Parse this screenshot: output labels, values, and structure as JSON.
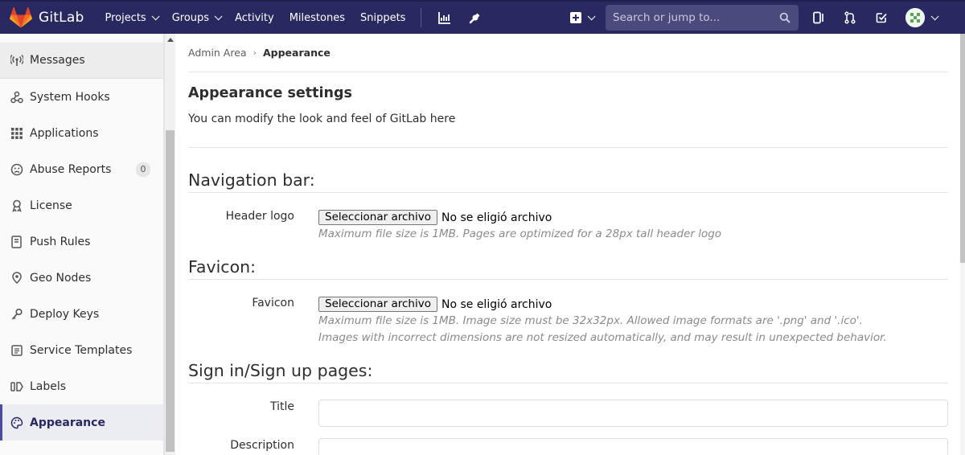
{
  "navbar": {
    "brand": "GitLab",
    "links": [
      "Projects",
      "Groups",
      "Activity",
      "Milestones",
      "Snippets"
    ],
    "search_placeholder": "Search or jump to..."
  },
  "sidebar": {
    "items": [
      {
        "label": "Messages",
        "icon": "broadcast-icon"
      },
      {
        "label": "System Hooks",
        "icon": "hook-icon"
      },
      {
        "label": "Applications",
        "icon": "applications-grid-icon"
      },
      {
        "label": "Abuse Reports",
        "icon": "abuse-face-icon",
        "count": "0"
      },
      {
        "label": "License",
        "icon": "license-icon"
      },
      {
        "label": "Push Rules",
        "icon": "push-rules-icon"
      },
      {
        "label": "Geo Nodes",
        "icon": "geo-pin-icon"
      },
      {
        "label": "Deploy Keys",
        "icon": "key-icon"
      },
      {
        "label": "Service Templates",
        "icon": "service-templates-icon"
      },
      {
        "label": "Labels",
        "icon": "labels-icon"
      },
      {
        "label": "Appearance",
        "icon": "appearance-palette-icon"
      }
    ]
  },
  "breadcrumb": {
    "parent": "Admin Area",
    "current": "Appearance"
  },
  "main": {
    "title": "Appearance settings",
    "description": "You can modify the look and feel of GitLab here",
    "sections": {
      "navigation": {
        "legend": "Navigation bar:",
        "field_label": "Header logo",
        "button_label": "Seleccionar archivo",
        "file_status": "No se eligió archivo",
        "help": "Maximum file size is 1MB. Pages are optimized for a 28px tall header logo"
      },
      "favicon": {
        "legend": "Favicon:",
        "field_label": "Favicon",
        "button_label": "Seleccionar archivo",
        "file_status": "No se eligió archivo",
        "help_line1": "Maximum file size is 1MB. Image size must be 32x32px. Allowed image formats are '.png' and '.ico'.",
        "help_line2": "Images with incorrect dimensions are not resized automatically, and may result in unexpected behavior."
      },
      "signin": {
        "legend": "Sign in/Sign up pages:",
        "title_label": "Title",
        "title_value": "",
        "description_label": "Description",
        "description_value": ""
      }
    }
  },
  "colors": {
    "navbar_bg": "#292961",
    "accent": "#4b4ba3",
    "gitlab_orange": "#e24329"
  }
}
